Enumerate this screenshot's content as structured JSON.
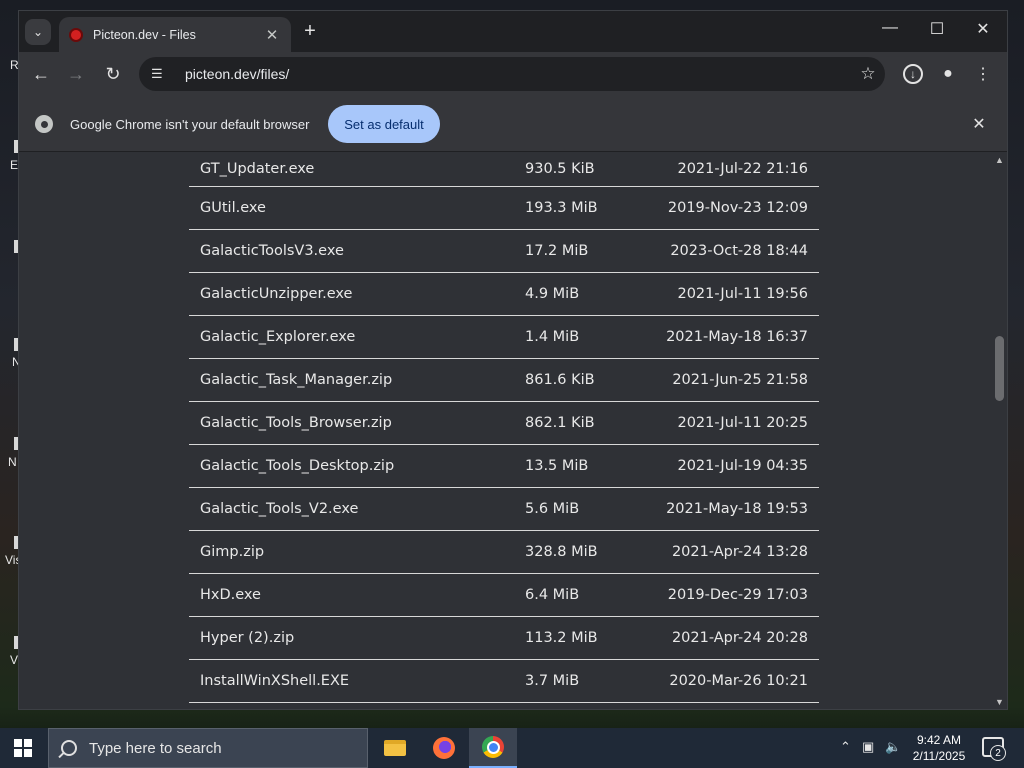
{
  "browser": {
    "tab_title": "Picteon.dev - Files",
    "url": "picteon.dev/files/",
    "infobar_text": "Google Chrome isn't your default browser",
    "set_default_label": "Set as default"
  },
  "files": [
    {
      "name": "GT_Updater.exe",
      "size": "930.5 KiB",
      "date": "2021-Jul-22 21:16"
    },
    {
      "name": "GUtil.exe",
      "size": "193.3 MiB",
      "date": "2019-Nov-23 12:09"
    },
    {
      "name": "GalacticToolsV3.exe",
      "size": "17.2 MiB",
      "date": "2023-Oct-28 18:44"
    },
    {
      "name": "GalacticUnzipper.exe",
      "size": "4.9 MiB",
      "date": "2021-Jul-11 19:56"
    },
    {
      "name": "Galactic_Explorer.exe",
      "size": "1.4 MiB",
      "date": "2021-May-18 16:37"
    },
    {
      "name": "Galactic_Task_Manager.zip",
      "size": "861.6 KiB",
      "date": "2021-Jun-25 21:58"
    },
    {
      "name": "Galactic_Tools_Browser.zip",
      "size": "862.1 KiB",
      "date": "2021-Jul-11 20:25"
    },
    {
      "name": "Galactic_Tools_Desktop.zip",
      "size": "13.5 MiB",
      "date": "2021-Jul-19 04:35"
    },
    {
      "name": "Galactic_Tools_V2.exe",
      "size": "5.6 MiB",
      "date": "2021-May-18 19:53"
    },
    {
      "name": "Gimp.zip",
      "size": "328.8 MiB",
      "date": "2021-Apr-24 13:28"
    },
    {
      "name": "HxD.exe",
      "size": "6.4 MiB",
      "date": "2019-Dec-29 17:03"
    },
    {
      "name": "Hyper (2).zip",
      "size": "113.2 MiB",
      "date": "2021-Apr-24 20:28"
    },
    {
      "name": "InstallWinXShell.EXE",
      "size": "3.7 MiB",
      "date": "2020-Mar-26 10:21"
    }
  ],
  "taskbar": {
    "search_placeholder": "Type here to search",
    "time": "9:42 AM",
    "date": "2/11/2025",
    "notification_count": "2"
  },
  "desktop": {
    "fragments": [
      "R",
      "E",
      "N",
      "N",
      "Vis",
      "V"
    ]
  }
}
